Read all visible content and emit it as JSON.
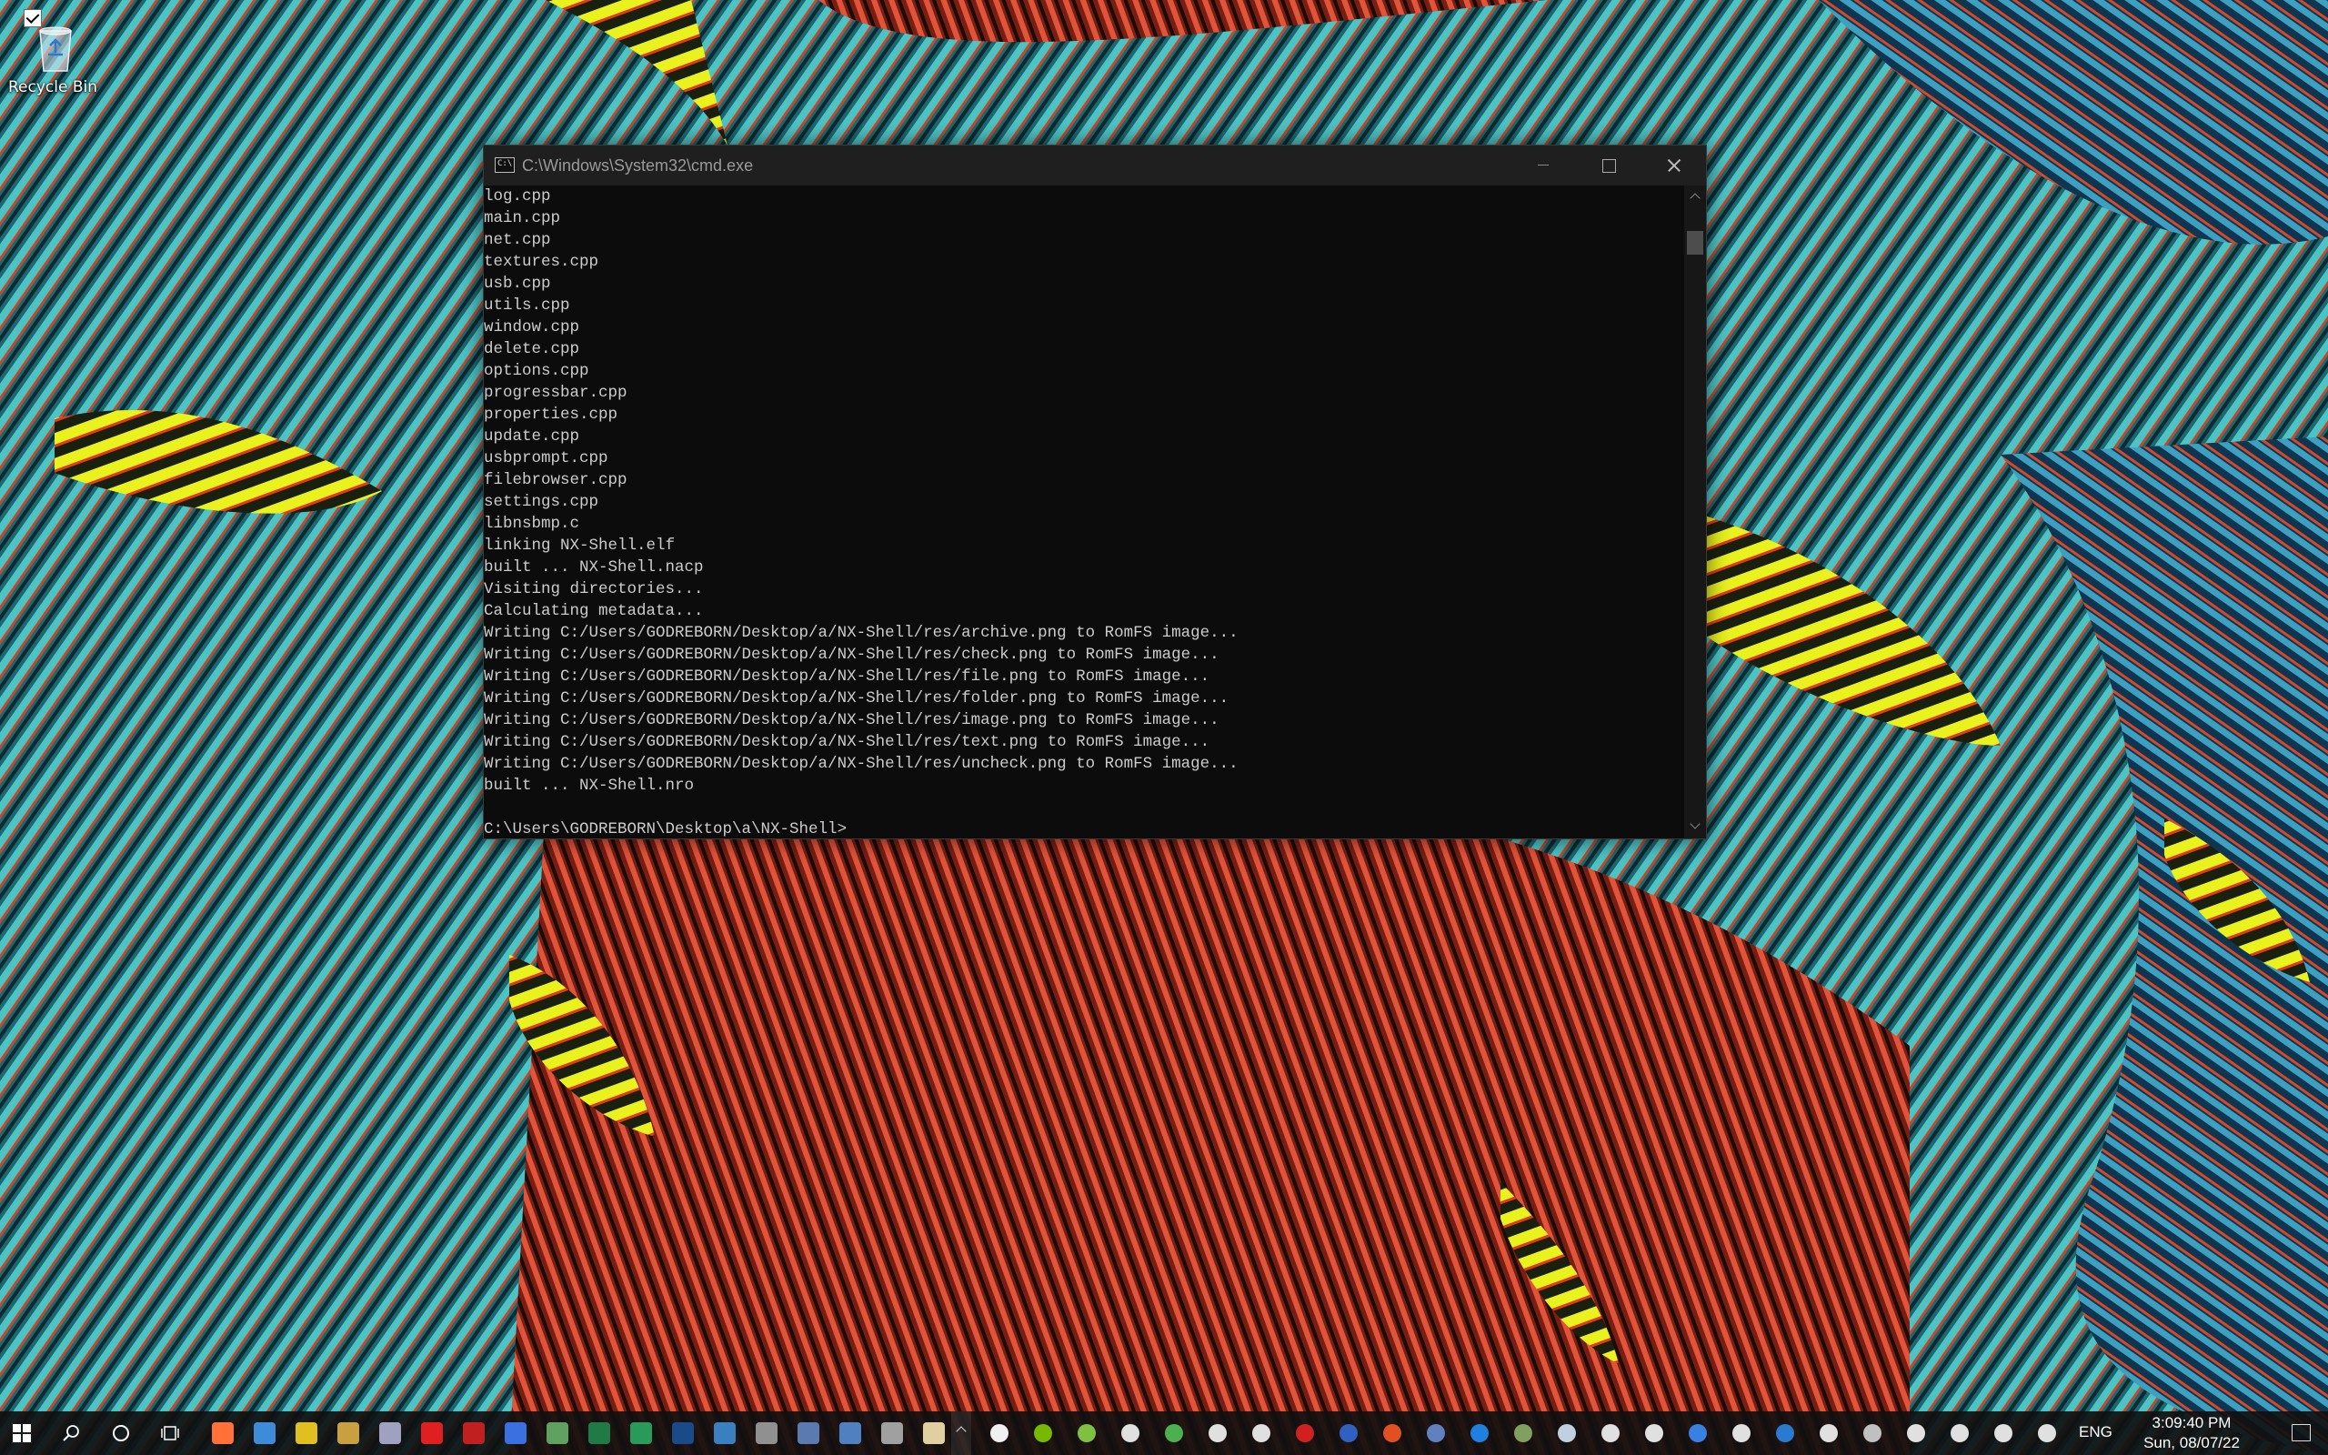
{
  "desktop": {
    "icons": [
      {
        "label": "Recycle Bin"
      }
    ]
  },
  "console": {
    "title": "C:\\Windows\\System32\\cmd.exe",
    "lines": [
      "log.cpp",
      "main.cpp",
      "net.cpp",
      "textures.cpp",
      "usb.cpp",
      "utils.cpp",
      "window.cpp",
      "delete.cpp",
      "options.cpp",
      "progressbar.cpp",
      "properties.cpp",
      "update.cpp",
      "usbprompt.cpp",
      "filebrowser.cpp",
      "settings.cpp",
      "libnsbmp.c",
      "linking NX-Shell.elf",
      "built ... NX-Shell.nacp",
      "Visiting directories...",
      "Calculating metadata...",
      "Writing C:/Users/GODREBORN/Desktop/a/NX-Shell/res/archive.png to RomFS image...",
      "Writing C:/Users/GODREBORN/Desktop/a/NX-Shell/res/check.png to RomFS image...",
      "Writing C:/Users/GODREBORN/Desktop/a/NX-Shell/res/file.png to RomFS image...",
      "Writing C:/Users/GODREBORN/Desktop/a/NX-Shell/res/folder.png to RomFS image...",
      "Writing C:/Users/GODREBORN/Desktop/a/NX-Shell/res/image.png to RomFS image...",
      "Writing C:/Users/GODREBORN/Desktop/a/NX-Shell/res/text.png to RomFS image...",
      "Writing C:/Users/GODREBORN/Desktop/a/NX-Shell/res/uncheck.png to RomFS image...",
      "built ... NX-Shell.nro",
      "",
      "C:\\Users\\GODREBORN\\Desktop\\a\\NX-Shell>"
    ]
  },
  "taskbar": {
    "pinned_apps": [
      {
        "icon": "firefox-icon",
        "color": "#ff7139"
      },
      {
        "icon": "browser-icon",
        "color": "#3d8bd9"
      },
      {
        "icon": "tool-icon",
        "color": "#e0c020"
      },
      {
        "icon": "globe-icon",
        "color": "#c8a040"
      },
      {
        "icon": "rocket-icon",
        "color": "#a0a0c0"
      },
      {
        "icon": "qb-icon",
        "color": "#e02020"
      },
      {
        "icon": "filezilla-icon",
        "color": "#c02020"
      },
      {
        "icon": "window-app-icon",
        "color": "#3a70e0"
      },
      {
        "icon": "image-app-icon",
        "color": "#60a060"
      },
      {
        "icon": "excel-icon",
        "color": "#1f7a45"
      },
      {
        "icon": "spreadsheet-icon",
        "color": "#2a9a5a"
      },
      {
        "icon": "photoshop-icon",
        "color": "#1a4a8a"
      },
      {
        "icon": "remote-icon",
        "color": "#3a80c0"
      },
      {
        "icon": "keyboard-icon",
        "color": "#909090"
      },
      {
        "icon": "calculator-icon",
        "color": "#5a7ab0"
      },
      {
        "icon": "laptop-icon",
        "color": "#5080c0"
      },
      {
        "icon": "cursor-icon",
        "color": "#a0a0a0"
      },
      {
        "icon": "brush-icon",
        "color": "#e0d0a0"
      }
    ],
    "tray_apps": [
      {
        "icon": "weather-icon",
        "color": "#f0f0f0"
      },
      {
        "icon": "nvidia-icon",
        "color": "#76b900"
      },
      {
        "icon": "y-icon",
        "color": "#80c040"
      },
      {
        "icon": "discord-icon",
        "color": "#e0e0e0"
      },
      {
        "icon": "wechat-icon",
        "color": "#4cb050"
      },
      {
        "icon": "docker-icon",
        "color": "#e0e0e0"
      },
      {
        "icon": "record-icon",
        "color": "#e0e0e0"
      },
      {
        "icon": "acrobat-icon",
        "color": "#d02020"
      },
      {
        "icon": "font-icon",
        "color": "#3060c0"
      },
      {
        "icon": "qx-icon",
        "color": "#e05020"
      },
      {
        "icon": "device-icon",
        "color": "#6080c0"
      },
      {
        "icon": "lightning-icon",
        "color": "#2080e0"
      },
      {
        "icon": "tool2-icon",
        "color": "#80a060"
      },
      {
        "icon": "steam-icon",
        "color": "#c0d0e0"
      },
      {
        "icon": "lifebuoy-icon",
        "color": "#e0e0e0"
      },
      {
        "icon": "lifebuoy2-icon",
        "color": "#e0e0e0"
      },
      {
        "icon": "qbittorrent-icon",
        "color": "#3a80e0"
      },
      {
        "icon": "download-icon",
        "color": "#e0e0e0"
      },
      {
        "icon": "bluetooth-icon",
        "color": "#2a7ad0"
      },
      {
        "icon": "defender-icon",
        "color": "#e0e0e0"
      },
      {
        "icon": "monitor-icon",
        "color": "#c0c0c0"
      },
      {
        "icon": "battery-icon",
        "color": "#e0e0e0"
      },
      {
        "icon": "wifi-icon",
        "color": "#e0e0e0"
      },
      {
        "icon": "volume-icon",
        "color": "#e0e0e0"
      },
      {
        "icon": "usb-icon",
        "color": "#e0e0e0"
      }
    ],
    "language": "ENG",
    "clock_time": "3:09:40 PM",
    "clock_date": "Sun, 08/07/22"
  }
}
